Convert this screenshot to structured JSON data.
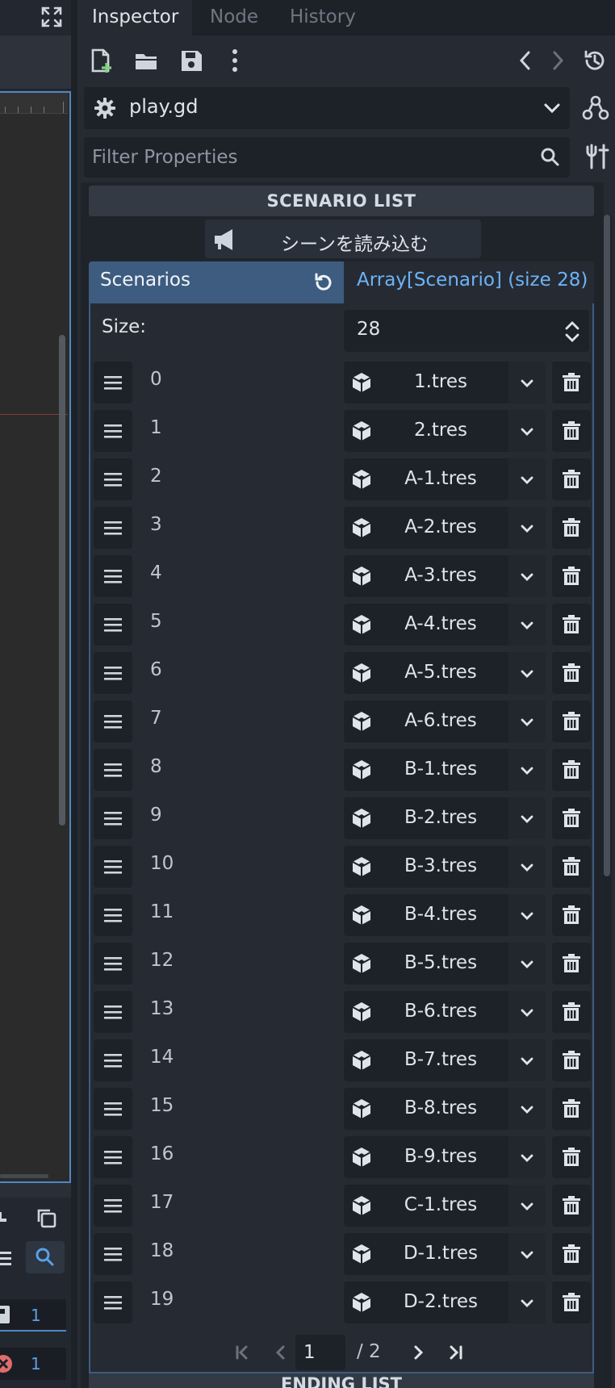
{
  "tabs": [
    {
      "label": "Inspector",
      "active": true
    },
    {
      "label": "Node",
      "active": false
    },
    {
      "label": "History",
      "active": false
    }
  ],
  "toolbar_icons": [
    "new-resource-icon",
    "open-folder-icon",
    "save-icon",
    "more-vertical-icon",
    "back-icon",
    "forward-icon",
    "history-icon"
  ],
  "resource": {
    "name": "play.gd",
    "icon": "gear-icon"
  },
  "filter": {
    "placeholder": "Filter Properties"
  },
  "section": {
    "title": "SCENARIO LIST",
    "next_title": "ENDING LIST"
  },
  "load_button": {
    "label": "シーンを読み込む",
    "icon": "megaphone-icon"
  },
  "array": {
    "label": "Scenarios",
    "type_label": "Array[Scenario] (size 28)",
    "size_label": "Size:",
    "size": "28",
    "items": [
      {
        "index": "0",
        "value": "1.tres"
      },
      {
        "index": "1",
        "value": "2.tres"
      },
      {
        "index": "2",
        "value": "A-1.tres"
      },
      {
        "index": "3",
        "value": "A-2.tres"
      },
      {
        "index": "4",
        "value": "A-3.tres"
      },
      {
        "index": "5",
        "value": "A-4.tres"
      },
      {
        "index": "6",
        "value": "A-5.tres"
      },
      {
        "index": "7",
        "value": "A-6.tres"
      },
      {
        "index": "8",
        "value": "B-1.tres"
      },
      {
        "index": "9",
        "value": "B-2.tres"
      },
      {
        "index": "10",
        "value": "B-3.tres"
      },
      {
        "index": "11",
        "value": "B-4.tres"
      },
      {
        "index": "12",
        "value": "B-5.tres"
      },
      {
        "index": "13",
        "value": "B-6.tres"
      },
      {
        "index": "14",
        "value": "B-7.tres"
      },
      {
        "index": "15",
        "value": "B-8.tres"
      },
      {
        "index": "16",
        "value": "B-9.tres"
      },
      {
        "index": "17",
        "value": "C-1.tres"
      },
      {
        "index": "18",
        "value": "D-1.tres"
      },
      {
        "index": "19",
        "value": "D-2.tres"
      }
    ],
    "page": "1",
    "page_total": "/ 2"
  },
  "left_panel": {
    "row_counts": [
      "1",
      "1"
    ]
  },
  "colors": {
    "accent": "#4f87c2",
    "accent_text": "#6db3f8",
    "panel": "#262b33",
    "field": "#1d2229"
  }
}
